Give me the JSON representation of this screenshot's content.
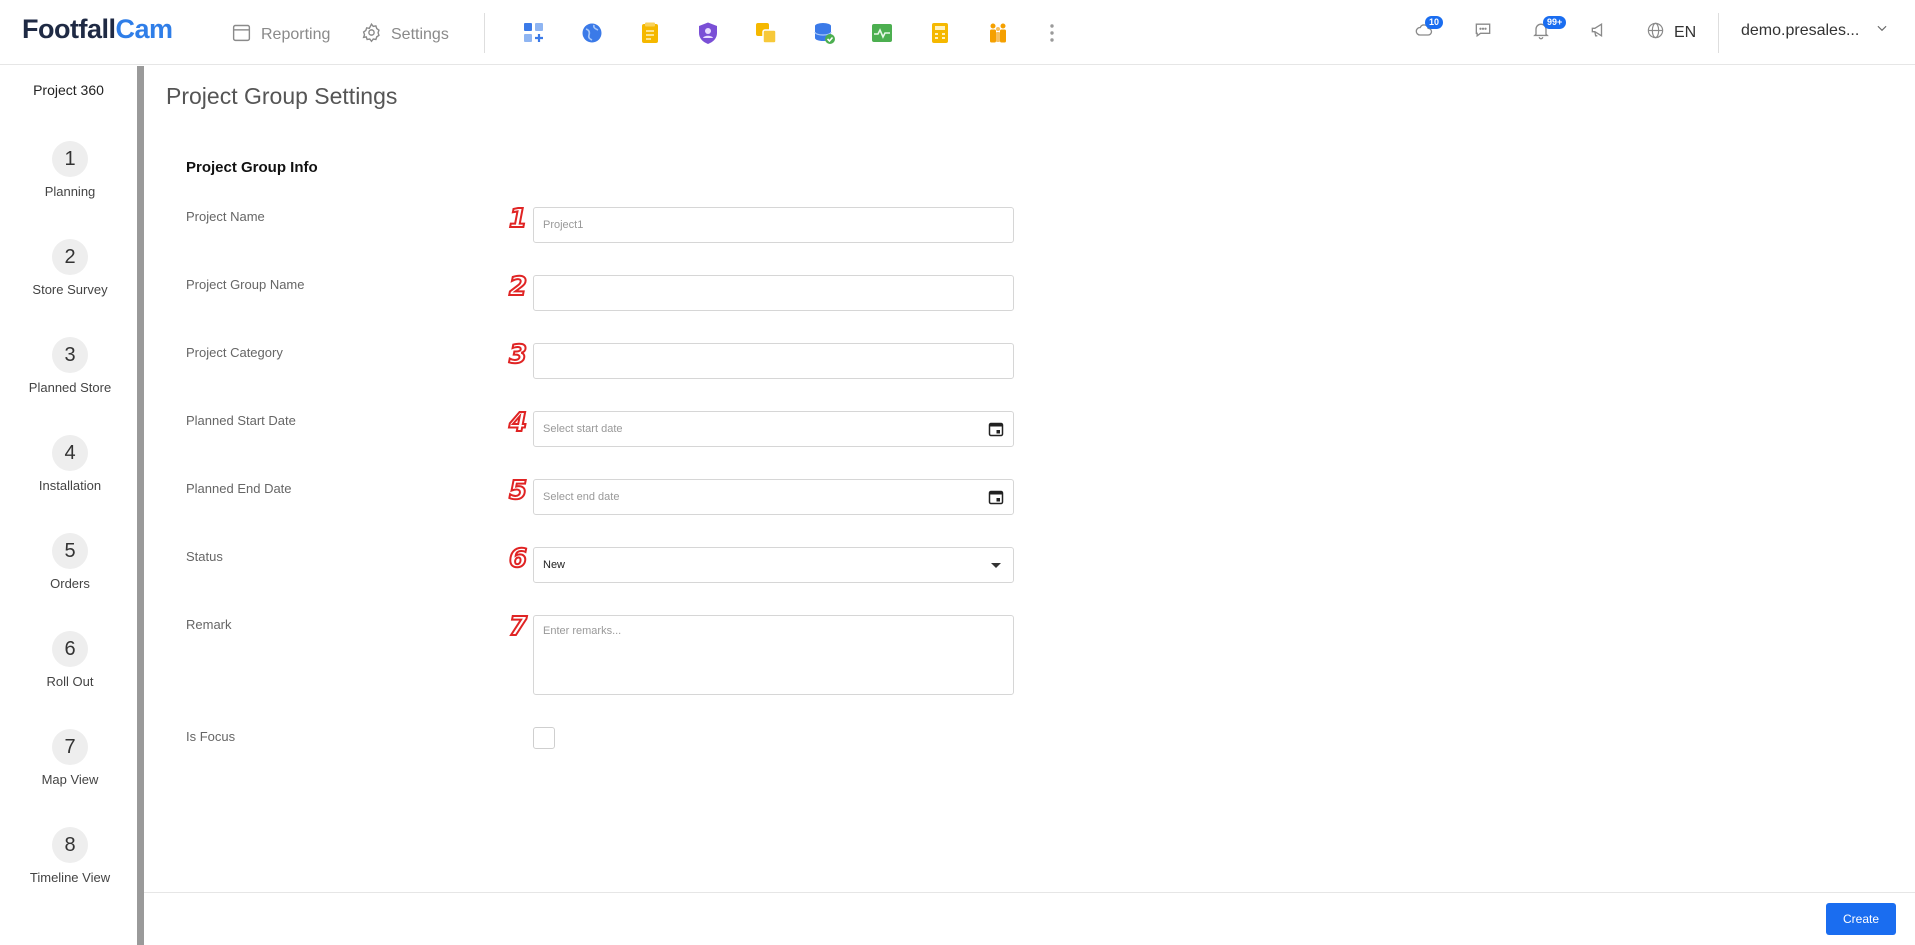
{
  "header": {
    "logo_part1": "Footfall",
    "logo_part2": "Cam",
    "nav": [
      {
        "label": "Reporting",
        "icon": "calendar-icon"
      },
      {
        "label": "Settings",
        "icon": "gear-icon"
      }
    ],
    "apps": [
      {
        "icon": "dashboard-add-icon",
        "color": "#3b7ae8"
      },
      {
        "icon": "globe-icon",
        "color": "#3b7ae8"
      },
      {
        "icon": "notepad-icon",
        "color": "#f5b800"
      },
      {
        "icon": "user-shield-icon",
        "color": "#7a4fd6"
      },
      {
        "icon": "layers-icon",
        "color": "#f5b800"
      },
      {
        "icon": "database-check-icon",
        "color": "#3b7ae8"
      },
      {
        "icon": "activity-chart-icon",
        "color": "#4caf50"
      },
      {
        "icon": "calculator-icon",
        "color": "#f5b800"
      },
      {
        "icon": "people-icon",
        "color": "#f5a000"
      }
    ],
    "cloud_badge": "10",
    "notification_badge": "99+",
    "language": "EN",
    "username": "demo.presales..."
  },
  "sidebar": {
    "title": "Project 360",
    "steps": [
      {
        "num": "1",
        "label": "Planning"
      },
      {
        "num": "2",
        "label": "Store Survey"
      },
      {
        "num": "3",
        "label": "Planned Store"
      },
      {
        "num": "4",
        "label": "Installation"
      },
      {
        "num": "5",
        "label": "Orders"
      },
      {
        "num": "6",
        "label": "Roll Out"
      },
      {
        "num": "7",
        "label": "Map View"
      },
      {
        "num": "8",
        "label": "Timeline View"
      }
    ]
  },
  "main": {
    "page_title": "Project Group Settings",
    "section_title": "Project Group Info",
    "fields": {
      "project_name": {
        "label": "Project Name",
        "value": "Project1",
        "marker": "1"
      },
      "group_name": {
        "label": "Project Group Name",
        "value": "",
        "marker": "2"
      },
      "category": {
        "label": "Project Category",
        "value": "",
        "marker": "3"
      },
      "start_date": {
        "label": "Planned Start Date",
        "placeholder": "Select start date",
        "marker": "4"
      },
      "end_date": {
        "label": "Planned End Date",
        "placeholder": "Select end date",
        "marker": "5"
      },
      "status": {
        "label": "Status",
        "value": "New",
        "marker": "6"
      },
      "remark": {
        "label": "Remark",
        "placeholder": "Enter remarks...",
        "marker": "7"
      },
      "is_focus": {
        "label": "Is Focus",
        "checked": false
      }
    },
    "create_label": "Create"
  }
}
